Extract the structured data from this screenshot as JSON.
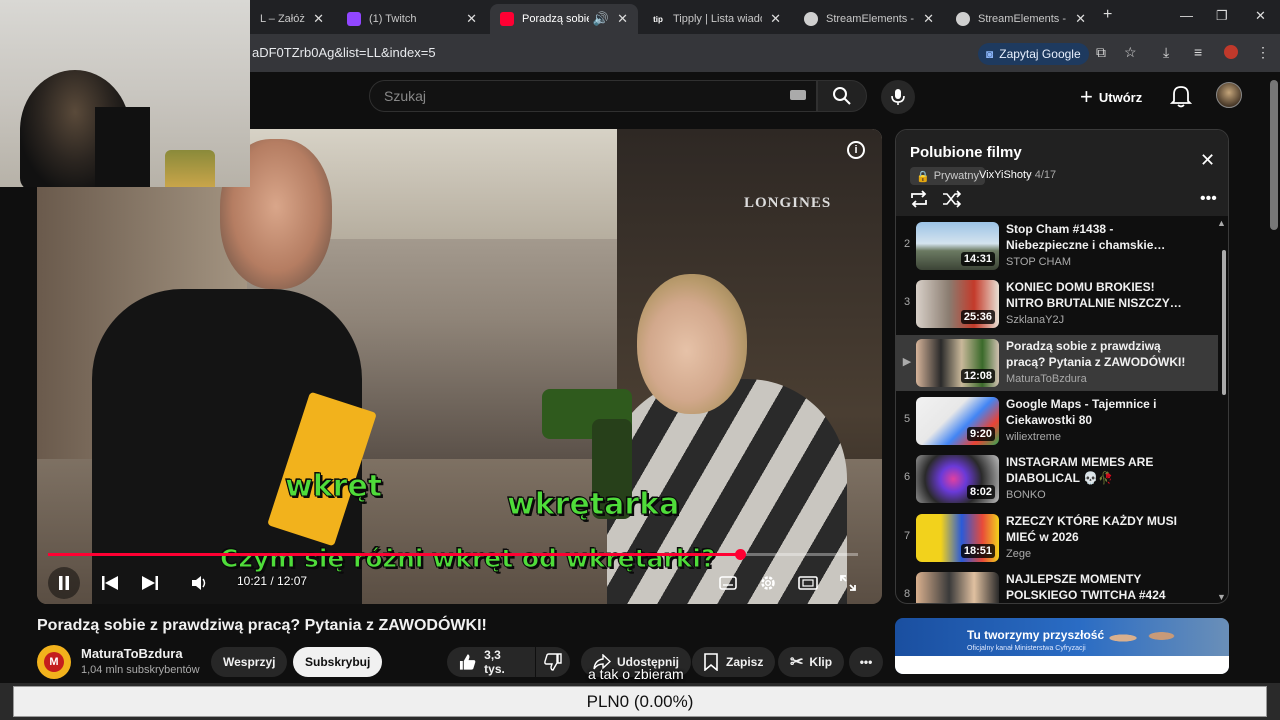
{
  "browser": {
    "tabs": [
      {
        "title": "L – Załóż kon",
        "fav_color": "#3c6ad8"
      },
      {
        "title": "(1) Twitch",
        "fav_color": "#9146ff"
      },
      {
        "title": "Poradzą sobie z pr",
        "fav_color": "#ff0033"
      },
      {
        "title": "Tipply | Lista wiadom",
        "fav_color": "#202124",
        "fav_text": "tip"
      },
      {
        "title": "StreamElements - Ov",
        "fav_color": "#cfcfcf"
      },
      {
        "title": "StreamElements - vi",
        "fav_color": "#cfcfcf"
      }
    ],
    "url": "aDF0TZrb0Ag&list=LL&index=5",
    "ask_google_label": "Zapytaj Google"
  },
  "youtube": {
    "search_placeholder": "Szukaj",
    "create_label": "Utwórz"
  },
  "player": {
    "store_sign": "LONGINES",
    "caption_1": "wkręt",
    "caption_2": "wkrętarka",
    "caption_3": "Czym się różni wkręt od wkrętarki?",
    "current_time": "10:21",
    "duration": "12:07",
    "time_display": "10:21 / 12:07",
    "progress": 0.854,
    "accent": "#ff0033"
  },
  "video": {
    "title": "Poradzą sobie z prawdziwą pracą? Pytania z ZAWODÓWKI!",
    "channel": "MaturaToBzdura",
    "channel_initial": "M",
    "subscribers": "1,04 mln subskrybentów",
    "support_label": "Wesprzyj",
    "subscribe_label": "Subskrybuj",
    "likes": "3,3 tys.",
    "share_label": "Udostępnij",
    "save_label": "Zapisz",
    "clip_label": "Klip"
  },
  "overlay_caption": "a tak o zbieram",
  "playlist": {
    "title": "Polubione filmy",
    "privacy": "Prywatny",
    "owner": "VixYiShoty",
    "position": "- 4/17",
    "items": [
      {
        "index": "2",
        "title": "Stop Cham #1438 - Niebezpieczne i chamskie…",
        "channel": "STOP CHAM",
        "duration": "14:31",
        "thumb": "linear-gradient(180deg,#9cc3e6 0%,#d4e3ee 45%,#6b7a62 60%,#3c4436 100%)"
      },
      {
        "index": "3",
        "title": "KONIEC DOMU BROKIES! NITRO BRUTALNIE NISZCZY…",
        "channel": "SzklanaY2J",
        "duration": "25:36",
        "thumb": "linear-gradient(90deg,#d8d0c8 0%,#8a7c70 40%,#c43a2a 70%,#e8e0d4 100%)"
      },
      {
        "index": "▶",
        "title": "Poradzą sobie z prawdziwą pracą? Pytania z ZAWODÓWKI!",
        "channel": "MaturaToBzdura",
        "duration": "12:08",
        "thumb": "linear-gradient(90deg,#d6b49a 0%,#2a2a2a 30%,#c9b89a 55%,#3a6a2a 80%,#d0c0b0 100%)",
        "current": true
      },
      {
        "index": "5",
        "title": "Google Maps - Tajemnice i Ciekawostki 80",
        "channel": "wiliextreme",
        "duration": "9:20",
        "thumb": "linear-gradient(135deg,#f2f2f2 0%,#e8e8e8 40%,#4285f4 60%,#ea4335 80%,#34a853 100%)"
      },
      {
        "index": "6",
        "title": "INSTAGRAM MEMES ARE DIABOLICAL 💀🥀",
        "channel": "BONKO",
        "duration": "8:02",
        "thumb": "radial-gradient(circle at 45% 50%,#e040a0 0%,#6a3ad8 25%,#2a2a2a 55%,#bdbdbd 100%)"
      },
      {
        "index": "7",
        "title": "RZECZY KTÓRE KAŻDY MUSI MIEĆ w 2026",
        "channel": "Zege",
        "duration": "18:51",
        "thumb": "linear-gradient(90deg,#f2d21c 0%,#f2d21c 30%,#2a5ad8 55%,#e84a3a 80%,#f2d21c 100%)"
      },
      {
        "index": "8",
        "title": "NAJLEPSZE MOMENTY POLSKIEGO TWITCHA #424",
        "channel": "",
        "duration": "",
        "thumb": "linear-gradient(90deg,#d9b08e 0%,#3a3a3a 40%,#e0c0a0 70%,#2a2a2a 100%)"
      }
    ]
  },
  "ad": {
    "headline": "Tu tworzymy przyszłość",
    "subtext": "Oficjalny kanał Ministerstwa Cyfryzacji"
  },
  "ticker": {
    "text": "PLN0 (0.00%)"
  }
}
